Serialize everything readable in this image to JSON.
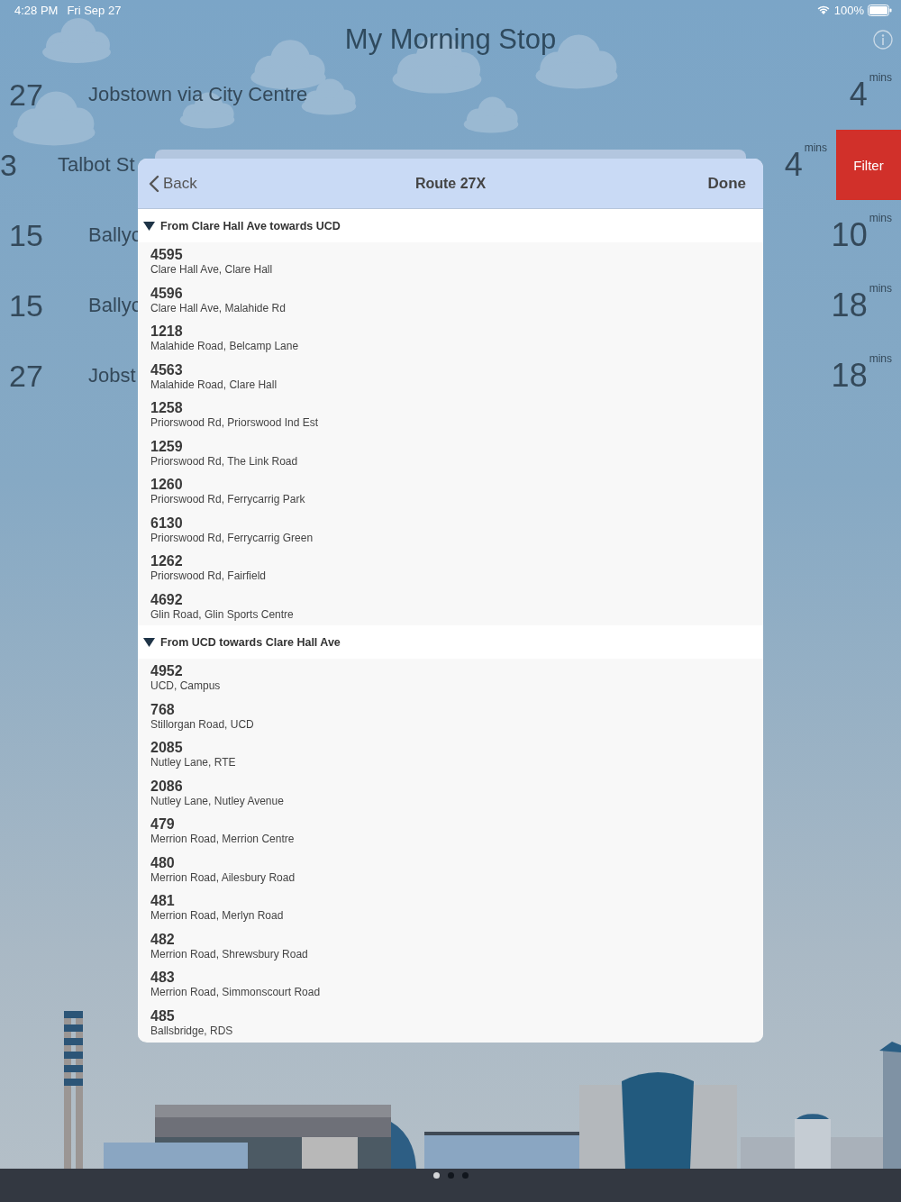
{
  "status_bar": {
    "time": "4:28 PM",
    "date": "Fri Sep 27",
    "battery": "100%"
  },
  "title": "My Morning Stop",
  "arrivals": [
    {
      "route": "27",
      "destination": "Jobstown via City Centre",
      "due": "4",
      "unit": "mins",
      "swiped": false
    },
    {
      "route": "3",
      "destination": "Talbot St",
      "due": "4",
      "unit": "mins",
      "swiped": true,
      "action": "Filter"
    },
    {
      "route": "15",
      "destination": "Ballyc",
      "due": "10",
      "unit": "mins",
      "swiped": false
    },
    {
      "route": "15",
      "destination": "Ballyc",
      "due": "18",
      "unit": "mins",
      "swiped": false
    },
    {
      "route": "27",
      "destination": "Jobst",
      "due": "18",
      "unit": "mins",
      "swiped": false
    }
  ],
  "modal": {
    "back": "Back",
    "title": "Route 27X",
    "done": "Done",
    "sections": [
      {
        "title": "From Clare Hall Ave towards UCD",
        "expanded": true,
        "stops": [
          {
            "number": "4595",
            "name": "Clare Hall Ave, Clare Hall"
          },
          {
            "number": "4596",
            "name": "Clare Hall Ave, Malahide Rd"
          },
          {
            "number": "1218",
            "name": "Malahide Road, Belcamp Lane"
          },
          {
            "number": "4563",
            "name": "Malahide Road, Clare Hall"
          },
          {
            "number": "1258",
            "name": "Priorswood Rd, Priorswood Ind Est"
          },
          {
            "number": "1259",
            "name": "Priorswood Rd, The Link Road"
          },
          {
            "number": "1260",
            "name": "Priorswood Rd, Ferrycarrig Park"
          },
          {
            "number": "6130",
            "name": "Priorswood Rd, Ferrycarrig Green"
          },
          {
            "number": "1262",
            "name": "Priorswood Rd, Fairfield"
          },
          {
            "number": "4692",
            "name": "Glin Road, Glin Sports Centre"
          }
        ]
      },
      {
        "title": "From UCD towards Clare Hall Ave",
        "expanded": true,
        "stops": [
          {
            "number": "4952",
            "name": "UCD, Campus"
          },
          {
            "number": "768",
            "name": "Stillorgan Road, UCD"
          },
          {
            "number": "2085",
            "name": "Nutley Lane, RTE"
          },
          {
            "number": "2086",
            "name": "Nutley Lane, Nutley Avenue"
          },
          {
            "number": "479",
            "name": "Merrion Road, Merrion Centre"
          },
          {
            "number": "480",
            "name": "Merrion Road, Ailesbury Road"
          },
          {
            "number": "481",
            "name": "Merrion Road, Merlyn Road"
          },
          {
            "number": "482",
            "name": "Merrion Road, Shrewsbury Road"
          },
          {
            "number": "483",
            "name": "Merrion Road, Simmonscourt Road"
          },
          {
            "number": "485",
            "name": "Ballsbridge, RDS"
          }
        ]
      }
    ]
  },
  "page_dots": [
    {
      "selected": true
    },
    {
      "selected": false
    },
    {
      "selected": false
    }
  ]
}
